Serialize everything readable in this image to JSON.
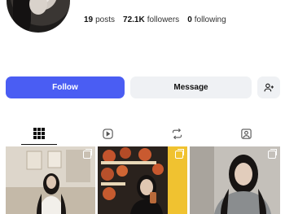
{
  "profile": {
    "stats": [
      {
        "value": "19",
        "label": "posts"
      },
      {
        "value": "72.1K",
        "label": "followers"
      },
      {
        "value": "0",
        "label": "following"
      }
    ]
  },
  "actions": {
    "follow_label": "Follow",
    "message_label": "Message"
  },
  "tabs": [
    {
      "icon": "grid-icon",
      "active": true
    },
    {
      "icon": "reels-icon",
      "active": false
    },
    {
      "icon": "reposts-icon",
      "active": false
    },
    {
      "icon": "tagged-icon",
      "active": false
    }
  ],
  "posts": [
    {
      "icon": "multi-photo-icon"
    },
    {
      "icon": "multi-photo-icon"
    },
    {
      "icon": "multi-photo-icon"
    }
  ],
  "colors": {
    "follow_button": "#4a5df3",
    "secondary_button": "#eff1f4"
  }
}
